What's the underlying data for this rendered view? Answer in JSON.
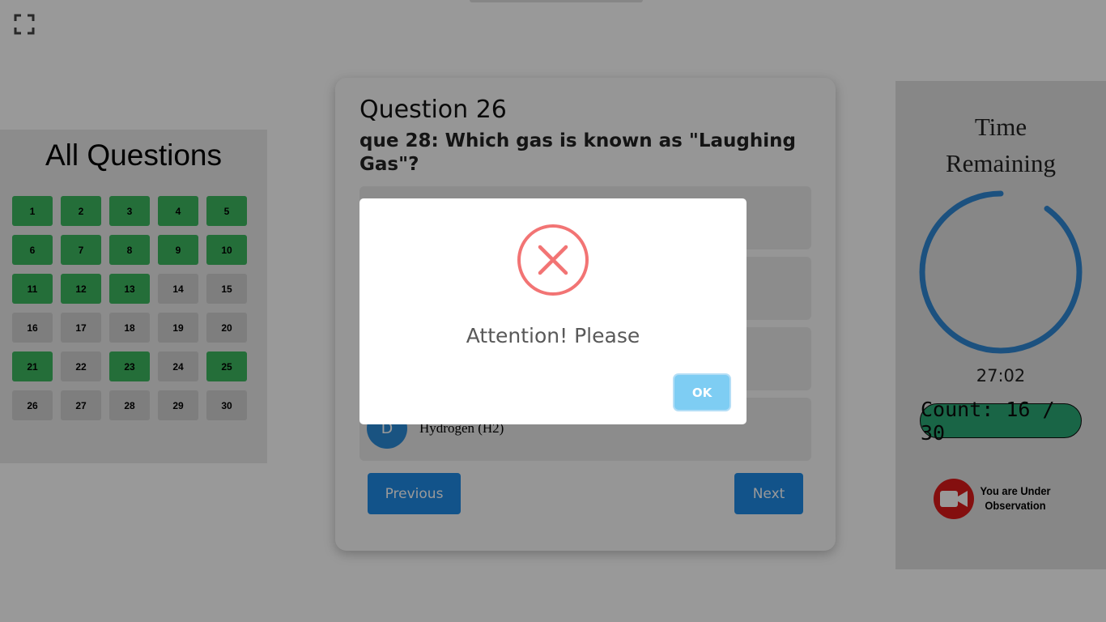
{
  "question_panel": {
    "title": "All Questions",
    "questions": [
      {
        "label": "1",
        "status": "answered"
      },
      {
        "label": "2",
        "status": "answered"
      },
      {
        "label": "3",
        "status": "answered"
      },
      {
        "label": "4",
        "status": "answered"
      },
      {
        "label": "5",
        "status": "answered"
      },
      {
        "label": "6",
        "status": "answered"
      },
      {
        "label": "7",
        "status": "answered"
      },
      {
        "label": "8",
        "status": "answered"
      },
      {
        "label": "9",
        "status": "answered"
      },
      {
        "label": "10",
        "status": "answered"
      },
      {
        "label": "11",
        "status": "answered"
      },
      {
        "label": "12",
        "status": "answered"
      },
      {
        "label": "13",
        "status": "answered"
      },
      {
        "label": "14",
        "status": "unanswered"
      },
      {
        "label": "15",
        "status": "unanswered"
      },
      {
        "label": "16",
        "status": "unanswered"
      },
      {
        "label": "17",
        "status": "unanswered"
      },
      {
        "label": "18",
        "status": "unanswered"
      },
      {
        "label": "19",
        "status": "unanswered"
      },
      {
        "label": "20",
        "status": "unanswered"
      },
      {
        "label": "21",
        "status": "answered"
      },
      {
        "label": "22",
        "status": "unanswered"
      },
      {
        "label": "23",
        "status": "answered"
      },
      {
        "label": "24",
        "status": "unanswered"
      },
      {
        "label": "25",
        "status": "answered"
      },
      {
        "label": "26",
        "status": "unanswered"
      },
      {
        "label": "27",
        "status": "unanswered"
      },
      {
        "label": "28",
        "status": "unanswered"
      },
      {
        "label": "29",
        "status": "unanswered"
      },
      {
        "label": "30",
        "status": "unanswered"
      }
    ]
  },
  "question_card": {
    "number_label": "Question 26",
    "text": "que 28: Which gas is known as \"Laughing Gas\"?",
    "options": [
      {
        "letter": "D",
        "text": "Hydrogen (H2)"
      }
    ],
    "previous_label": "Previous",
    "next_label": "Next"
  },
  "side_panel": {
    "timer_label_line1": "Time",
    "timer_label_line2": "Remaining",
    "timer_value": "27:02",
    "timer_progress_fraction": 0.9,
    "count_text": "Count: 16 / 30",
    "observation_line1": "You are Under",
    "observation_line2": "Observation"
  },
  "modal": {
    "title": "Attention! Please",
    "ok_label": "OK"
  },
  "colors": {
    "answered": "#3cb860",
    "unanswered": "#d2d2d2",
    "primary": "#1f8ae6",
    "timer_ring": "#2f88d4",
    "error": "#f27474",
    "ok_button": "#7ecdf3",
    "count_badge": "#2aa876",
    "camera": "#dc1a1a"
  },
  "icons": {
    "fullscreen": "fullscreen-icon",
    "error": "error-x-icon",
    "camera": "video-camera-icon"
  }
}
